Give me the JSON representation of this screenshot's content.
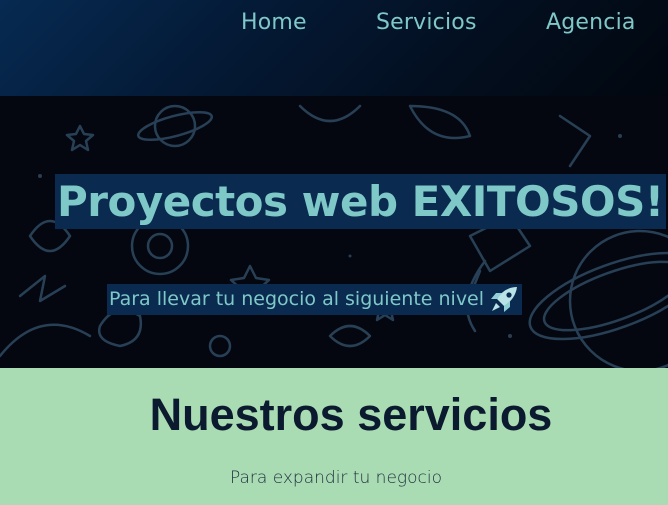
{
  "nav": {
    "home_label": "Home",
    "servicios_label": "Servicios",
    "agencia_label": "Agencia"
  },
  "hero": {
    "title": "Proyectos web EXITOSOS!",
    "subtitle": "Para llevar tu negocio al siguiente nivel",
    "subtitle_icon": "rocket-icon"
  },
  "services": {
    "title": "Nuestros servicios",
    "subtitle": "Para expandir tu negocio"
  },
  "colors": {
    "nav_text": "#7fc8c8",
    "hero_highlight_bg": "#0a2a50",
    "services_bg": "#aadcb4",
    "services_title": "#0b1a2e"
  }
}
